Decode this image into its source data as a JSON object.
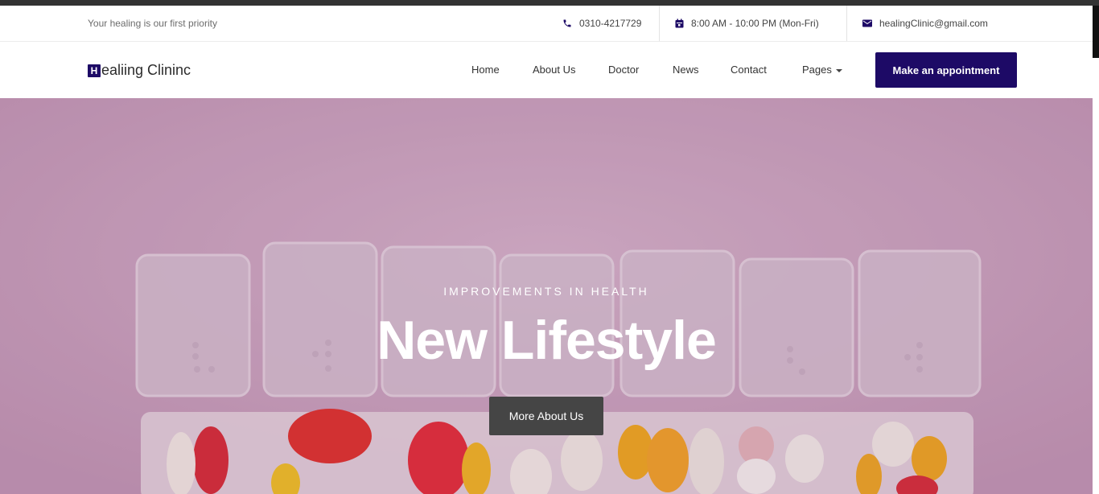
{
  "topbar": {
    "tagline": "Your healing is our first priority",
    "phone": "0310-4217729",
    "hours": "8:00 AM - 10:00 PM (Mon-Fri)",
    "email": "healingClinic@gmail.com"
  },
  "brand": {
    "logo_letter": "H",
    "logo_rest": "ealiing Clininc",
    "accent": "#1d0a66"
  },
  "nav": {
    "items": [
      "Home",
      "About Us",
      "Doctor",
      "News",
      "Contact",
      "Pages"
    ],
    "cta": "Make an appointment"
  },
  "hero": {
    "eyebrow": "IMPROVEMENTS IN HEALTH",
    "title": "New Lifestyle",
    "button": "More About Us"
  },
  "icons": {
    "phone": "phone-icon",
    "calendar": "calendar-icon",
    "mail": "mail-icon",
    "dropdown": "caret-down-icon"
  }
}
